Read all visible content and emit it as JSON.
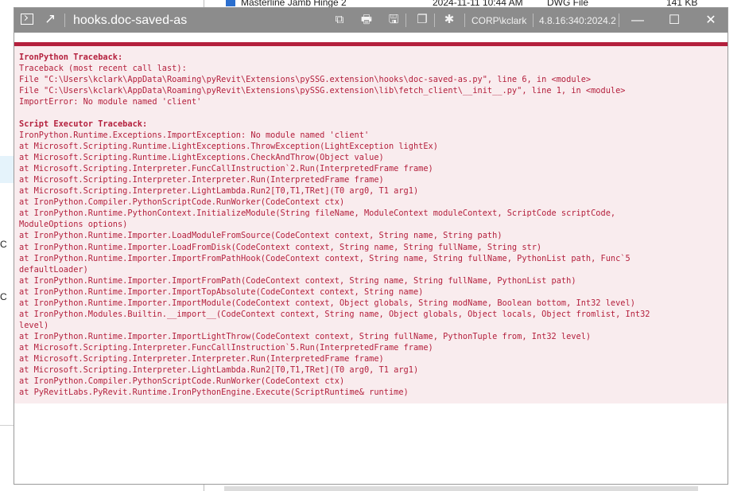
{
  "background": {
    "file_row": {
      "name": "Masterline Jamb Hinge 2",
      "date": "2024-11-11 10:44 AM",
      "type": "DWG File",
      "size": "141 KB"
    },
    "left_labels": [
      "C",
      "C"
    ]
  },
  "window": {
    "title": "hooks.doc-saved-as",
    "user": "CORP\\kclark",
    "version": "4.8.16:340:2024.2",
    "buttons": {
      "minimize": "—",
      "maximize": "☐",
      "close": "✕"
    }
  },
  "traceback": {
    "ironpython": {
      "header": "IronPython Traceback:",
      "lines": [
        "Traceback (most recent call last):",
        "File \"C:\\Users\\kclark\\AppData\\Roaming\\pyRevit\\Extensions\\pySSG.extension\\hooks\\doc-saved-as.py\", line 6, in <module>",
        "File \"C:\\Users\\kclark\\AppData\\Roaming\\pyRevit\\Extensions\\pySSG.extension\\lib\\fetch_client\\__init__.py\", line 1, in <module>",
        "ImportError: No module named 'client'"
      ]
    },
    "executor": {
      "header": "Script Executor Traceback:",
      "lines": [
        "IronPython.Runtime.Exceptions.ImportException: No module named 'client'",
        "at Microsoft.Scripting.Runtime.LightExceptions.ThrowException(LightException lightEx)",
        "at Microsoft.Scripting.Runtime.LightExceptions.CheckAndThrow(Object value)",
        "at Microsoft.Scripting.Interpreter.FuncCallInstruction`2.Run(InterpretedFrame frame)",
        "at Microsoft.Scripting.Interpreter.Interpreter.Run(InterpretedFrame frame)",
        "at Microsoft.Scripting.Interpreter.LightLambda.Run2[T0,T1,TRet](T0 arg0, T1 arg1)",
        "at IronPython.Compiler.PythonScriptCode.RunWorker(CodeContext ctx)",
        "at IronPython.Runtime.PythonContext.InitializeModule(String fileName, ModuleContext moduleContext, ScriptCode scriptCode,\nModuleOptions options)",
        "at IronPython.Runtime.Importer.LoadModuleFromSource(CodeContext context, String name, String path)",
        "at IronPython.Runtime.Importer.LoadFromDisk(CodeContext context, String name, String fullName, String str)",
        "at IronPython.Runtime.Importer.ImportFromPathHook(CodeContext context, String name, String fullName, PythonList path, Func`5\ndefaultLoader)",
        "at IronPython.Runtime.Importer.ImportFromPath(CodeContext context, String name, String fullName, PythonList path)",
        "at IronPython.Runtime.Importer.ImportTopAbsolute(CodeContext context, String name)",
        "at IronPython.Runtime.Importer.ImportModule(CodeContext context, Object globals, String modName, Boolean bottom, Int32 level)",
        "at IronPython.Modules.Builtin.__import__(CodeContext context, String name, Object globals, Object locals, Object fromlist, Int32\nlevel)",
        "at IronPython.Runtime.Importer.ImportLightThrow(CodeContext context, String fullName, PythonTuple from, Int32 level)",
        "at Microsoft.Scripting.Interpreter.FuncCallInstruction`5.Run(InterpretedFrame frame)",
        "at Microsoft.Scripting.Interpreter.Interpreter.Run(InterpretedFrame frame)",
        "at Microsoft.Scripting.Interpreter.LightLambda.Run2[T0,T1,TRet](T0 arg0, T1 arg1)",
        "at IronPython.Compiler.PythonScriptCode.RunWorker(CodeContext ctx)",
        "at PyRevitLabs.PyRevit.Runtime.IronPythonEngine.Execute(ScriptRuntime& runtime)"
      ]
    }
  },
  "colors": {
    "accent": "#b4203d",
    "titlebar": "#8c8c8c",
    "panel": "#f9ecee"
  }
}
